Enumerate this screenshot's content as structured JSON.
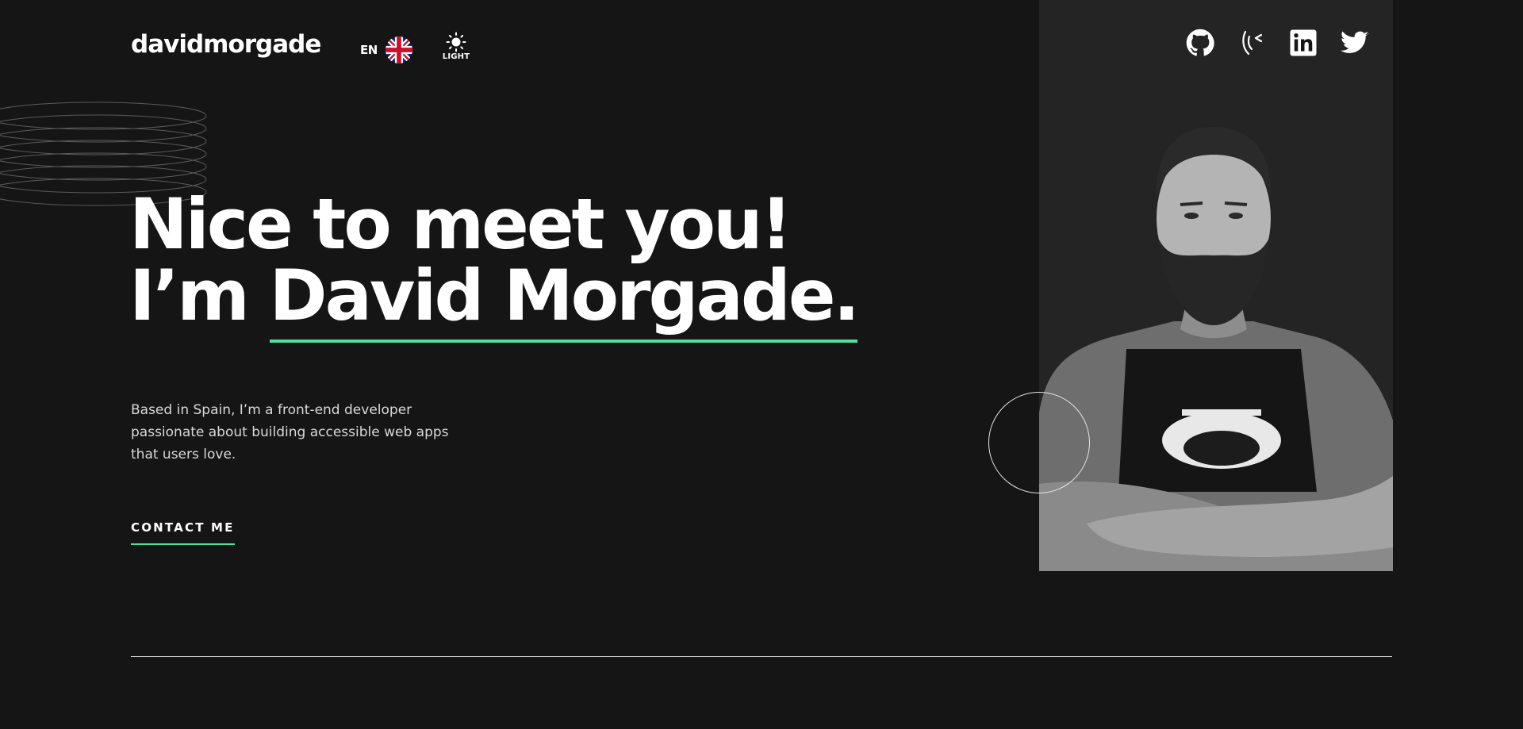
{
  "header": {
    "logo": "davidmorgade",
    "language_code": "EN",
    "theme_label": "LIGHT"
  },
  "socials": [
    {
      "icon": "github-icon"
    },
    {
      "icon": "custom-logo-icon"
    },
    {
      "icon": "linkedin-icon"
    },
    {
      "icon": "twitter-icon"
    }
  ],
  "hero": {
    "line1": "Nice to meet you!",
    "line2_prefix": "I’m ",
    "name": "David Morgade.",
    "intro": "Based in Spain, I’m a front-end developer passionate about building accessible web apps that users love.",
    "cta": "CONTACT ME"
  },
  "colors": {
    "background": "#151515",
    "panel": "#242424",
    "accent": "#4ee1a0",
    "text": "#ffffff"
  }
}
